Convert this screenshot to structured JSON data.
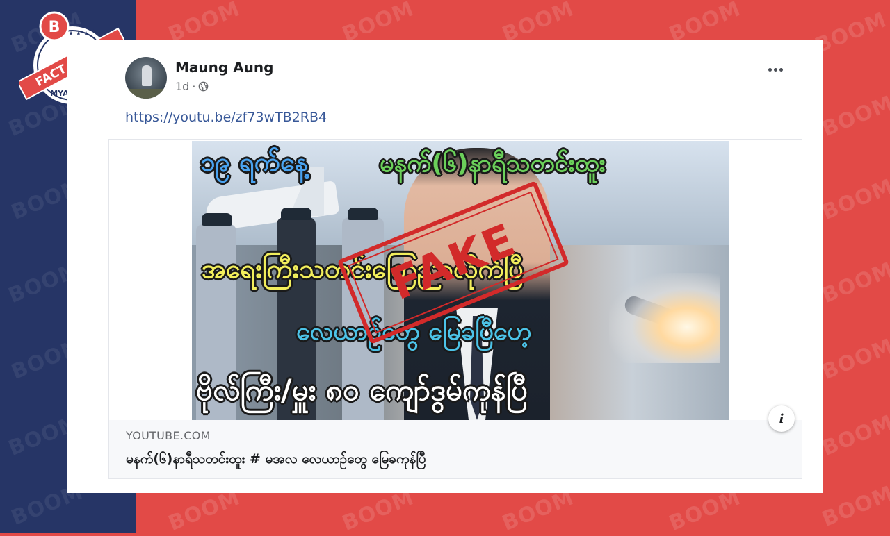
{
  "watermark": {
    "text": "BOOM"
  },
  "badge": {
    "letter": "B",
    "ribbon": "FACT CHECK",
    "country": "MYANMAR"
  },
  "post": {
    "author": "Maung Aung",
    "time": "1d",
    "audience_icon": "globe-icon",
    "link_text": "https://youtu.be/zf73wTB2RB4"
  },
  "preview": {
    "thumbnail_lines": [
      "၁၉ ရက်နေ့",
      "မနက်(၆)နာရီသတင်းထူး",
      "အရေးကြီးသတင်းကြေညာလိုက်ပြီ",
      "လေယာဉ်တွေ မြေခပြီဟေ့",
      "ဗိုလ်ကြီး/မှူး ၈၀ ကျော်ဒွမ်ကုန်ပြီ"
    ],
    "stamp": "FAKE",
    "domain": "YOUTUBE.COM",
    "title": "မနက်(၆)နာရီသတင်းထူး # မအလ လေယာဥ်တွေ မြေခကုန်ပြီ"
  },
  "colors": {
    "left_band": "#263566",
    "right_band": "#e24a47",
    "stamp": "#d22a2a",
    "link": "#385898"
  }
}
